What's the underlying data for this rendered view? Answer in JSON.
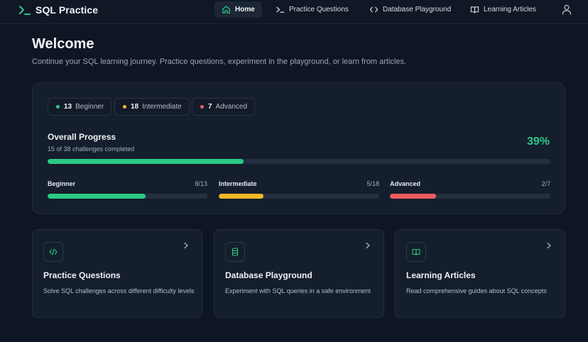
{
  "brand": {
    "name": "SQL Practice"
  },
  "nav": {
    "items": [
      {
        "label": "Home",
        "icon": "home-icon",
        "active": true
      },
      {
        "label": "Practice Questions",
        "icon": "terminal-icon",
        "active": false
      },
      {
        "label": "Database Playground",
        "icon": "code-icon",
        "active": false
      },
      {
        "label": "Learning Articles",
        "icon": "book-icon",
        "active": false
      }
    ],
    "user_icon": "user-icon"
  },
  "welcome": {
    "title": "Welcome",
    "subtitle": "Continue your SQL learning journey. Practice questions, experiment in the playground, or learn from articles."
  },
  "progress": {
    "chips": [
      {
        "count": "13",
        "label": "Beginner",
        "color": "#2bc985"
      },
      {
        "count": "18",
        "label": "Intermediate",
        "color": "#f2b824"
      },
      {
        "count": "7",
        "label": "Advanced",
        "color": "#ef5b5f"
      }
    ],
    "overall": {
      "title": "Overall Progress",
      "subtitle": "15 of 38 challenges completed",
      "percent_label": "39%",
      "fraction": 0.39
    },
    "levels": [
      {
        "label": "Beginner",
        "count_label": "8/13",
        "fraction": 0.615,
        "color": "#2bc985"
      },
      {
        "label": "Intermediate",
        "count_label": "5/18",
        "fraction": 0.278,
        "color": "#f2b824"
      },
      {
        "label": "Advanced",
        "count_label": "2/7",
        "fraction": 0.286,
        "color": "#ef5b5f"
      }
    ]
  },
  "features": [
    {
      "title": "Practice Questions",
      "description": "Solve SQL challenges across different difficulty levels",
      "icon": "code-icon"
    },
    {
      "title": "Database Playground",
      "description": "Experiment with SQL queries in a safe environment",
      "icon": "database-icon"
    },
    {
      "title": "Learning Articles",
      "description": "Read comprehensive guides about SQL concepts",
      "icon": "book-open-icon"
    }
  ],
  "colors": {
    "accent": "#2bc985",
    "background": "#0f1623",
    "card": "#151e2c"
  }
}
